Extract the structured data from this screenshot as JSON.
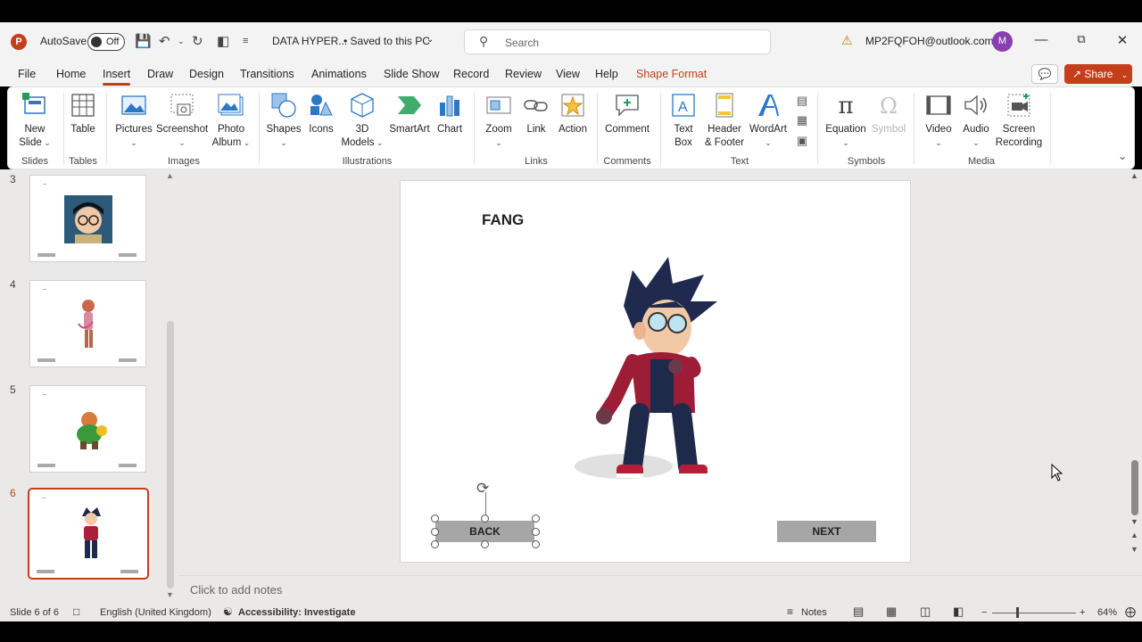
{
  "titlebar": {
    "autosave_label": "AutoSave",
    "autosave_state": "Off",
    "doc_name": "DATA HYPER...",
    "save_status": "• Saved to this PC",
    "search_placeholder": "Search",
    "account_email": "MP2FQFOH@outlook.com",
    "avatar_letter": "M"
  },
  "tabs": [
    "File",
    "Home",
    "Insert",
    "Draw",
    "Design",
    "Transitions",
    "Animations",
    "Slide Show",
    "Record",
    "Review",
    "View",
    "Help",
    "Shape Format"
  ],
  "share_label": "Share",
  "ribbon": {
    "buttons": {
      "new_slide": [
        "New",
        "Slide"
      ],
      "table": "Table",
      "pictures": "Pictures",
      "screenshot": "Screenshot",
      "photo_album": [
        "Photo",
        "Album"
      ],
      "shapes": "Shapes",
      "icons": "Icons",
      "models3d": [
        "3D",
        "Models"
      ],
      "smartart": "SmartArt",
      "chart": "Chart",
      "zoom": "Zoom",
      "link": "Link",
      "action": "Action",
      "comment": "Comment",
      "text_box": [
        "Text",
        "Box"
      ],
      "header_footer": [
        "Header",
        "& Footer"
      ],
      "wordart": "WordArt",
      "equation": "Equation",
      "symbol": "Symbol",
      "video": "Video",
      "audio": "Audio",
      "screen_recording": [
        "Screen",
        "Recording"
      ]
    },
    "groups": {
      "slides": "Slides",
      "tables": "Tables",
      "images": "Images",
      "illustrations": "Illustrations",
      "links": "Links",
      "comments": "Comments",
      "text": "Text",
      "symbols": "Symbols",
      "media": "Media"
    }
  },
  "thumbnails": [
    {
      "number": "3",
      "selected": false
    },
    {
      "number": "4",
      "selected": false
    },
    {
      "number": "5",
      "selected": false
    },
    {
      "number": "6",
      "selected": true
    }
  ],
  "slide": {
    "title": "FANG",
    "back_label": "BACK",
    "next_label": "NEXT"
  },
  "notes_placeholder": "Click to add notes",
  "status": {
    "slide_counter": "Slide 6 of 6",
    "language": "English (United Kingdom)",
    "accessibility": "Accessibility: Investigate",
    "notes_label": "Notes",
    "zoom": "64%"
  },
  "colors": {
    "accent": "#c43e1c",
    "ribbon_icon": "#2b78c6"
  }
}
